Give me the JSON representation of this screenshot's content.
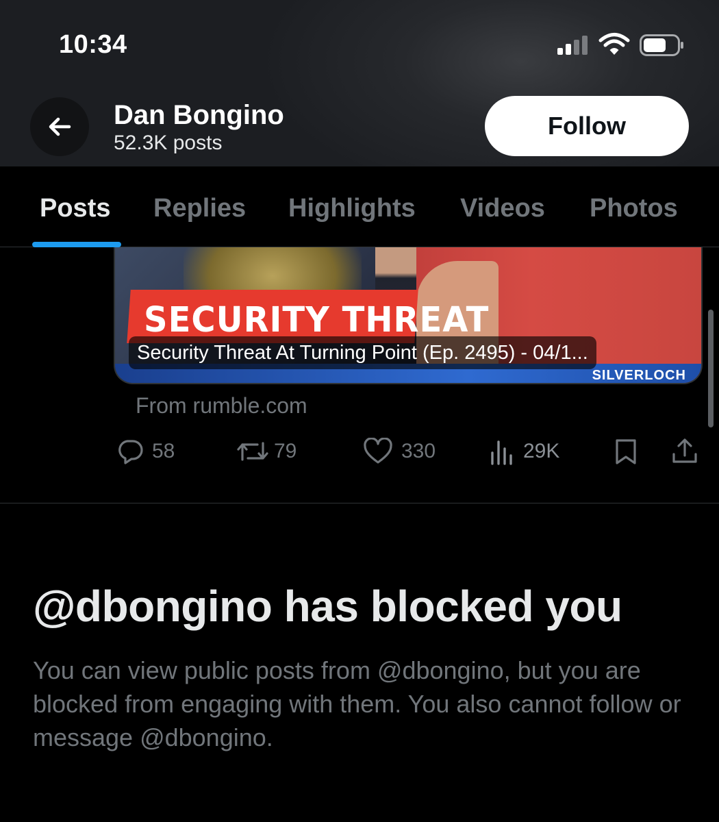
{
  "status_bar": {
    "time": "10:34",
    "signal_icon": "cellular-signal-icon",
    "wifi_icon": "wifi-icon",
    "battery_icon": "battery-icon"
  },
  "header": {
    "back_icon": "arrow-left-icon",
    "name": "Dan Bongino",
    "post_count": "52.3K posts",
    "follow_label": "Follow"
  },
  "tabs": [
    {
      "label": "Posts",
      "active": true
    },
    {
      "label": "Replies",
      "active": false
    },
    {
      "label": "Highlights",
      "active": false
    },
    {
      "label": "Videos",
      "active": false
    },
    {
      "label": "Photos",
      "active": false
    }
  ],
  "post": {
    "card": {
      "overlay_text": "SECURITY THREAT",
      "caption": "Security Threat At Turning Point (Ep. 2495) - 04/1...",
      "brand": "SILVERLOCH"
    },
    "source": "From rumble.com",
    "actions": {
      "replies": "58",
      "reposts": "79",
      "likes": "330",
      "views": "29K"
    }
  },
  "blocked": {
    "title": "@dbongino has blocked you",
    "description": "You can view public posts from @dbongino, but you are blocked from engaging with them. You also cannot follow or message @dbongino."
  },
  "colors": {
    "accent": "#1d9bf0",
    "background": "#000000",
    "muted_text": "#71767b"
  }
}
